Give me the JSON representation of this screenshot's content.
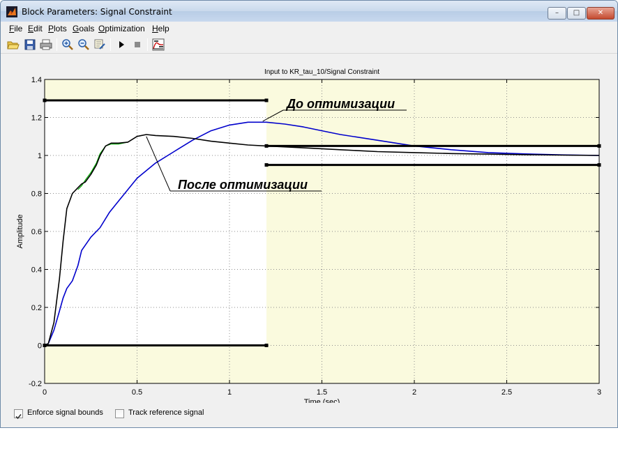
{
  "window": {
    "title": "Block Parameters: Signal Constraint",
    "minimize": "–",
    "maximize": "□",
    "close": "✕"
  },
  "menu": [
    "File",
    "Edit",
    "Plots",
    "Goals",
    "Optimization",
    "Help"
  ],
  "toolbar": {
    "icons": [
      "open-icon",
      "save-icon",
      "print-icon",
      "zoom-in-icon",
      "zoom-out-icon",
      "edit-axes-icon",
      "start-icon",
      "stop-icon",
      "response-plot-icon"
    ]
  },
  "plot": {
    "title": "Input to KR_tau_10/Signal Constraint",
    "annotation_before": "До оптимизации",
    "annotation_after": "После оптимизации"
  },
  "chart_data": {
    "type": "line",
    "title": "Input to KR_tau_10/Signal Constraint",
    "xlabel": "Time (sec)",
    "ylabel": "Amplitude",
    "xlim": [
      0,
      3
    ],
    "ylim": [
      -0.2,
      1.4
    ],
    "xticks": [
      "0",
      "0.5",
      "1",
      "1.5",
      "2",
      "2.5",
      "3"
    ],
    "yticks": [
      "-0.2",
      "0",
      "0.2",
      "0.4",
      "0.6",
      "0.8",
      "1",
      "1.2",
      "1.4"
    ],
    "grid": true,
    "colors": {
      "before": "#0000cc",
      "after": "#000000",
      "green": "#00aa00",
      "bound_region": "#fafade"
    },
    "bounds": [
      {
        "x": [
          0,
          1.2
        ],
        "y": [
          1.29,
          1.29
        ]
      },
      {
        "x": [
          1.2,
          3
        ],
        "y": [
          1.05,
          1.05
        ]
      },
      {
        "x": [
          1.2,
          3
        ],
        "y": [
          0.95,
          0.95
        ]
      },
      {
        "x": [
          0,
          1.2
        ],
        "y": [
          0,
          0
        ]
      }
    ],
    "series": [
      {
        "x": [
          0,
          0.02,
          0.05,
          0.08,
          0.1,
          0.12,
          0.15,
          0.18,
          0.2,
          0.25,
          0.3,
          0.35,
          0.4,
          0.45,
          0.5,
          0.55,
          0.6,
          0.7,
          0.8,
          0.9,
          1.0,
          1.1,
          1.2,
          1.3,
          1.4,
          1.5,
          1.6,
          1.8,
          2.0,
          2.2,
          2.4,
          2.6,
          2.8,
          3.0
        ],
        "y": [
          0,
          0.01,
          0.08,
          0.18,
          0.25,
          0.3,
          0.34,
          0.42,
          0.5,
          0.57,
          0.62,
          0.7,
          0.76,
          0.82,
          0.88,
          0.92,
          0.96,
          1.02,
          1.08,
          1.13,
          1.16,
          1.175,
          1.175,
          1.165,
          1.15,
          1.13,
          1.11,
          1.08,
          1.05,
          1.03,
          1.015,
          1.008,
          1.003,
          1.0
        ]
      },
      {
        "x": [
          0,
          0.02,
          0.05,
          0.08,
          0.1,
          0.12,
          0.15,
          0.18,
          0.2,
          0.22,
          0.25,
          0.28,
          0.3,
          0.33,
          0.36,
          0.4,
          0.45,
          0.5,
          0.55,
          0.6,
          0.7,
          0.8,
          0.9,
          1.0,
          1.1,
          1.2,
          1.4,
          1.6,
          1.8,
          2.0,
          2.2,
          2.4,
          2.6,
          2.8,
          3.0
        ],
        "y": [
          0,
          0.01,
          0.12,
          0.35,
          0.55,
          0.72,
          0.8,
          0.83,
          0.85,
          0.86,
          0.9,
          0.95,
          1.0,
          1.05,
          1.065,
          1.065,
          1.07,
          1.1,
          1.11,
          1.105,
          1.1,
          1.09,
          1.075,
          1.065,
          1.055,
          1.05,
          1.04,
          1.03,
          1.02,
          1.015,
          1.01,
          1.007,
          1.004,
          1.002,
          1.0
        ]
      },
      {
        "x": [
          0.18,
          0.2,
          0.22,
          0.25,
          0.28,
          0.3,
          0.33,
          0.36,
          0.4,
          0.45
        ],
        "y": [
          0.82,
          0.84,
          0.87,
          0.91,
          0.96,
          1.01,
          1.05,
          1.06,
          1.06,
          1.07
        ]
      }
    ]
  },
  "footer": {
    "enforce_label": "Enforce signal bounds",
    "enforce_checked": true,
    "track_label": "Track reference signal",
    "track_checked": false
  }
}
